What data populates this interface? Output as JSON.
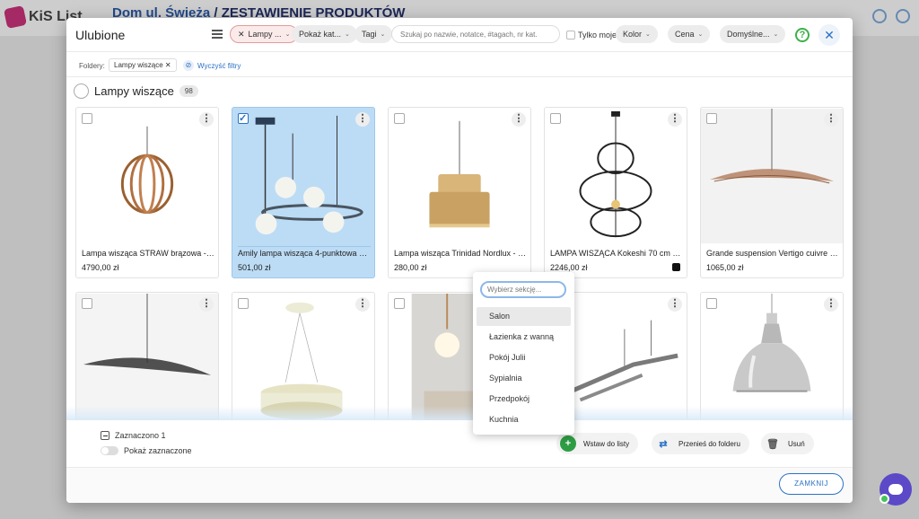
{
  "app": {
    "logo": "KiS List",
    "title_project": "Dom ul. Świeża",
    "title_sep": " / ",
    "title_page": "ZESTAWIENIE PRODUKTÓW"
  },
  "modal": {
    "title": "Ulubione",
    "toolbar": {
      "chip_folder": "Lampy ...",
      "chip_show": "Pokaż kat...",
      "chip_tags": "Tagi",
      "search_placeholder": "Szukaj po nazwie, notatce, #tagach, nr kat.",
      "only_mine": "Tylko moje",
      "chip_color": "Kolor",
      "chip_price": "Cena",
      "chip_sort": "Domyślne..."
    },
    "filters": {
      "label": "Foldery:",
      "tag": "Lampy wiszące",
      "clear": "Wyczyść filtry"
    },
    "group": {
      "name": "Lampy wiszące",
      "count": "98"
    },
    "products": [
      {
        "name": "Lampa wisząca STRAW brązowa - s...",
        "price": "4790,00 zł",
        "selected": false
      },
      {
        "name": "Amily lampa wisząca 4-punktowa zł...",
        "price": "501,00 zł",
        "selected": true
      },
      {
        "name": "Lampa wisząca Trinidad Nordlux - d...",
        "price": "280,00 zł",
        "selected": false
      },
      {
        "name": "LAMPA WISZĄCA Kokeshi 70 cm M...",
        "price": "2246,00 zł",
        "selected": false,
        "swatch": "#111111"
      },
      {
        "name": "Grande suspension Vertigo cuivre - ...",
        "price": "1065,00 zł",
        "selected": false
      }
    ],
    "dropdown": {
      "placeholder": "Wybierz sekcję...",
      "items": [
        "Salon",
        "Łazienka z wanną",
        "Pokój Julii",
        "Sypialnia",
        "Przedpokój",
        "Kuchnia"
      ]
    },
    "bottom": {
      "selected_count": "Zaznaczono 1",
      "show_selected": "Pokaż zaznaczone",
      "insert": "Wstaw do listy",
      "move": "Przenieś do folderu",
      "delete": "Usuń"
    },
    "close_button": "ZAMKNIJ"
  },
  "colors": {
    "accent": "#2a72c6",
    "selected_card": "#bcdcf5",
    "green": "#3cb14a",
    "chat": "#5b49c7"
  }
}
